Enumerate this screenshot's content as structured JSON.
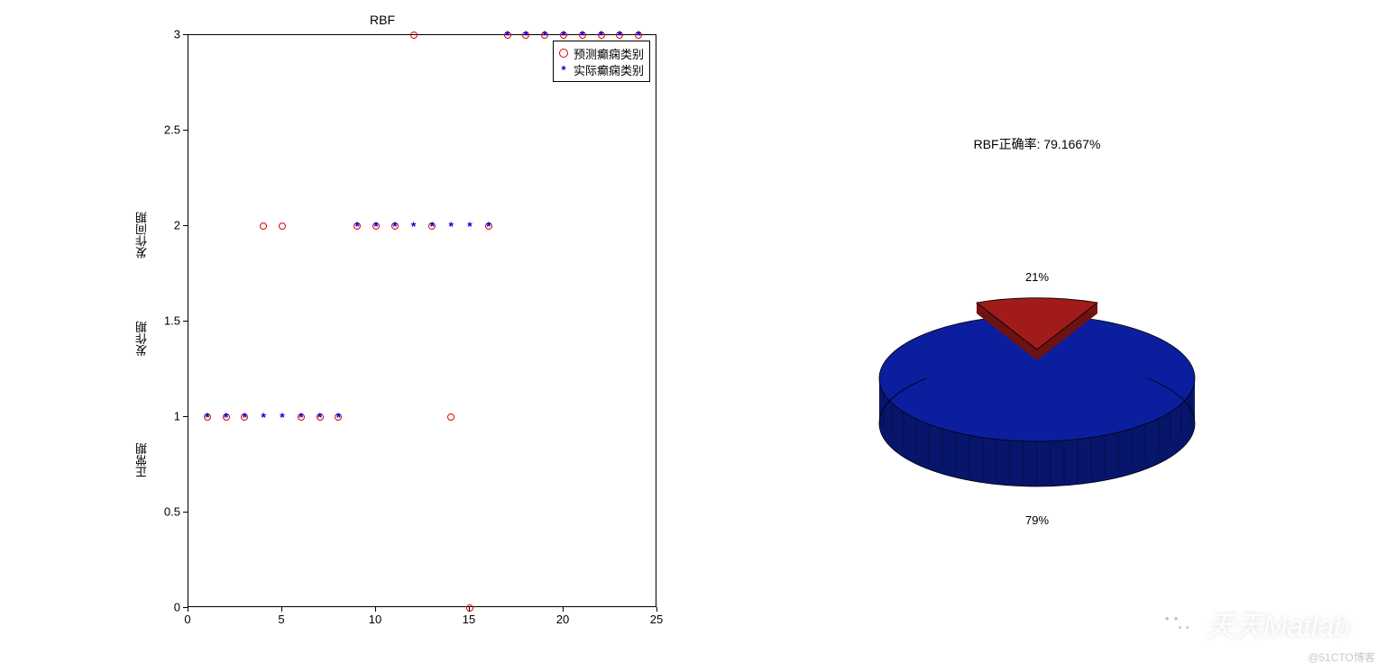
{
  "chart_data": [
    {
      "type": "scatter",
      "title": "RBF",
      "xlabel": "",
      "ylabel_segments": [
        "正常期",
        "发作期",
        "发作间期"
      ],
      "xlim": [
        0,
        25
      ],
      "ylim": [
        0,
        3
      ],
      "xticks": [
        0,
        5,
        10,
        15,
        20,
        25
      ],
      "yticks": [
        0,
        0.5,
        1,
        1.5,
        2,
        2.5,
        3
      ],
      "legend": [
        "预测癫痫类别",
        "实际癫痫类别"
      ],
      "series": [
        {
          "name": "预测癫痫类别",
          "marker": "o",
          "color": "#e00000",
          "points": [
            {
              "x": 1,
              "y": 1
            },
            {
              "x": 2,
              "y": 1
            },
            {
              "x": 3,
              "y": 1
            },
            {
              "x": 4,
              "y": 2
            },
            {
              "x": 5,
              "y": 2
            },
            {
              "x": 6,
              "y": 1
            },
            {
              "x": 7,
              "y": 1
            },
            {
              "x": 8,
              "y": 1
            },
            {
              "x": 9,
              "y": 2
            },
            {
              "x": 10,
              "y": 2
            },
            {
              "x": 11,
              "y": 2
            },
            {
              "x": 12,
              "y": 3
            },
            {
              "x": 13,
              "y": 2
            },
            {
              "x": 14,
              "y": 1
            },
            {
              "x": 15,
              "y": 0
            },
            {
              "x": 16,
              "y": 2
            },
            {
              "x": 17,
              "y": 3
            },
            {
              "x": 18,
              "y": 3
            },
            {
              "x": 19,
              "y": 3
            },
            {
              "x": 20,
              "y": 3
            },
            {
              "x": 21,
              "y": 3
            },
            {
              "x": 22,
              "y": 3
            },
            {
              "x": 23,
              "y": 3
            },
            {
              "x": 24,
              "y": 3
            }
          ]
        },
        {
          "name": "实际癫痫类别",
          "marker": "*",
          "color": "#0000e0",
          "points": [
            {
              "x": 1,
              "y": 1
            },
            {
              "x": 2,
              "y": 1
            },
            {
              "x": 3,
              "y": 1
            },
            {
              "x": 4,
              "y": 1
            },
            {
              "x": 5,
              "y": 1
            },
            {
              "x": 6,
              "y": 1
            },
            {
              "x": 7,
              "y": 1
            },
            {
              "x": 8,
              "y": 1
            },
            {
              "x": 9,
              "y": 2
            },
            {
              "x": 10,
              "y": 2
            },
            {
              "x": 11,
              "y": 2
            },
            {
              "x": 12,
              "y": 2
            },
            {
              "x": 13,
              "y": 2
            },
            {
              "x": 14,
              "y": 2
            },
            {
              "x": 15,
              "y": 2
            },
            {
              "x": 16,
              "y": 2
            },
            {
              "x": 17,
              "y": 3
            },
            {
              "x": 18,
              "y": 3
            },
            {
              "x": 19,
              "y": 3
            },
            {
              "x": 20,
              "y": 3
            },
            {
              "x": 21,
              "y": 3
            },
            {
              "x": 22,
              "y": 3
            },
            {
              "x": 23,
              "y": 3
            },
            {
              "x": 24,
              "y": 3
            }
          ]
        }
      ]
    },
    {
      "type": "pie",
      "title": "RBF正确率: 79.1667%",
      "slices": [
        {
          "label": "21%",
          "value": 20.8333,
          "color": "#a11b1b"
        },
        {
          "label": "79%",
          "value": 79.1667,
          "color": "#0b1e9e"
        }
      ]
    }
  ],
  "scatter": {
    "title": "RBF",
    "legend_pred": "预测癫痫类别",
    "legend_actual": "实际癫痫类别",
    "ylabels": {
      "normal": "正常期",
      "seizure": "发作期",
      "interictal": "发作间期"
    }
  },
  "pie": {
    "title": "RBF正确率: 79.1667%",
    "label_small": "21%",
    "label_large": "79%"
  },
  "watermark": {
    "text": "天天Matlab"
  },
  "footer": {
    "text": "@51CTO博客"
  }
}
